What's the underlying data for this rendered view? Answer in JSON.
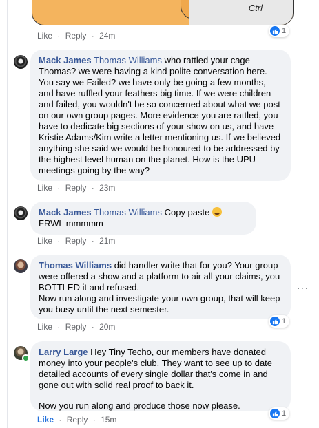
{
  "top_image": {
    "panel_text": "Ctrl"
  },
  "comments": [
    {
      "actions": {
        "like": "Like",
        "reply": "Reply",
        "time": "24m",
        "sep": "·"
      },
      "reactions": {
        "count": "1"
      }
    },
    {
      "author": "Mack James",
      "mention": "Thomas Williams",
      "text": " who rattled your cage Thomas? we were having a kind polite conversation here. You say we Failed? we have only be going a few months, and have ruffled your feathers big time. If we were children and failed, you wouldn't be so concerned about what we post on our own group pages. More evidence you are rattled, you have to dedicate big sections of your show on us, and have Kristie Adams/Kim write a letter mentioning us. If we believed anything she said we would be honoured to be addressed by the highest level human on the planet. How is the UPU meetings going by the way?",
      "actions": {
        "like": "Like",
        "reply": "Reply",
        "time": "23m",
        "sep": "·"
      }
    },
    {
      "author": "Mack James",
      "mention": "Thomas Williams",
      "text": " Copy paste ",
      "text_after_emoji": " FRWL mmmmm",
      "emoji": "rolling-laughing-emoji",
      "actions": {
        "like": "Like",
        "reply": "Reply",
        "time": "21m",
        "sep": "·"
      }
    },
    {
      "author": "Thomas Williams",
      "text": " did handler write that for you? Your group were offered a show and a platform to air all your claims, you BOTTLED it and refused.",
      "text2": "Now run along and investigate your own group, that will keep you busy until the next semester.",
      "actions": {
        "like": "Like",
        "reply": "Reply",
        "time": "20m",
        "sep": "·"
      },
      "reactions": {
        "count": "1"
      }
    },
    {
      "author": "Larry Large",
      "text": " Hey Tiny Techo, our members have donated money into your people's club. They want to see up to date detailed accounts of every single dollar that's come in and gone out with solid real proof to back it.",
      "text2": "Now you run along and produce those now please.",
      "actions": {
        "like": "Like",
        "reply": "Reply",
        "time": "15m",
        "sep": "·"
      },
      "reactions": {
        "count": "1"
      },
      "liked": true
    }
  ],
  "more_options": "···",
  "colors": {
    "accent": "#1877f2",
    "name": "#385898",
    "bubble": "#f0f2f5",
    "meta": "#65676b"
  }
}
